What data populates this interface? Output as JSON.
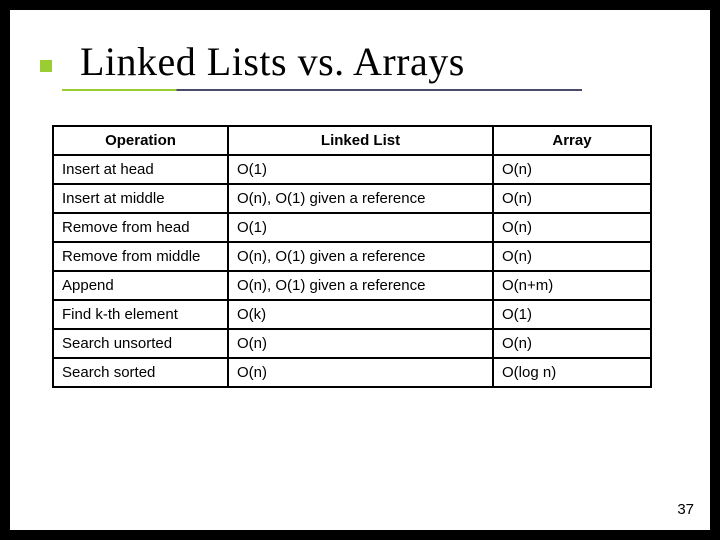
{
  "title": "Linked Lists vs. Arrays",
  "headers": {
    "op": "Operation",
    "ll": "Linked List",
    "arr": "Array"
  },
  "rows": [
    {
      "op": "Insert at head",
      "ll": "O(1)",
      "arr": "O(n)"
    },
    {
      "op": "Insert at middle",
      "ll": "O(n), O(1) given a reference",
      "arr": "O(n)"
    },
    {
      "op": "Remove from head",
      "ll": "O(1)",
      "arr": "O(n)"
    },
    {
      "op": "Remove from middle",
      "ll": "O(n), O(1) given a reference",
      "arr": "O(n)"
    },
    {
      "op": "Append",
      "ll": "O(n), O(1) given a reference",
      "arr": "O(n+m)"
    },
    {
      "op": "Find k-th element",
      "ll": "O(k)",
      "arr": "O(1)"
    },
    {
      "op": "Search unsorted",
      "ll": "O(n)",
      "arr": "O(n)"
    },
    {
      "op": "Search sorted",
      "ll": "O(n)",
      "arr": "O(log n)"
    }
  ],
  "page_number": "37",
  "chart_data": {
    "type": "table",
    "title": "Linked Lists vs. Arrays",
    "columns": [
      "Operation",
      "Linked List",
      "Array"
    ],
    "rows": [
      [
        "Insert at head",
        "O(1)",
        "O(n)"
      ],
      [
        "Insert at middle",
        "O(n), O(1) given a reference",
        "O(n)"
      ],
      [
        "Remove from head",
        "O(1)",
        "O(n)"
      ],
      [
        "Remove from middle",
        "O(n), O(1) given a reference",
        "O(n)"
      ],
      [
        "Append",
        "O(n), O(1) given a reference",
        "O(n+m)"
      ],
      [
        "Find k-th element",
        "O(k)",
        "O(1)"
      ],
      [
        "Search unsorted",
        "O(n)",
        "O(n)"
      ],
      [
        "Search sorted",
        "O(n)",
        "O(log n)"
      ]
    ]
  }
}
